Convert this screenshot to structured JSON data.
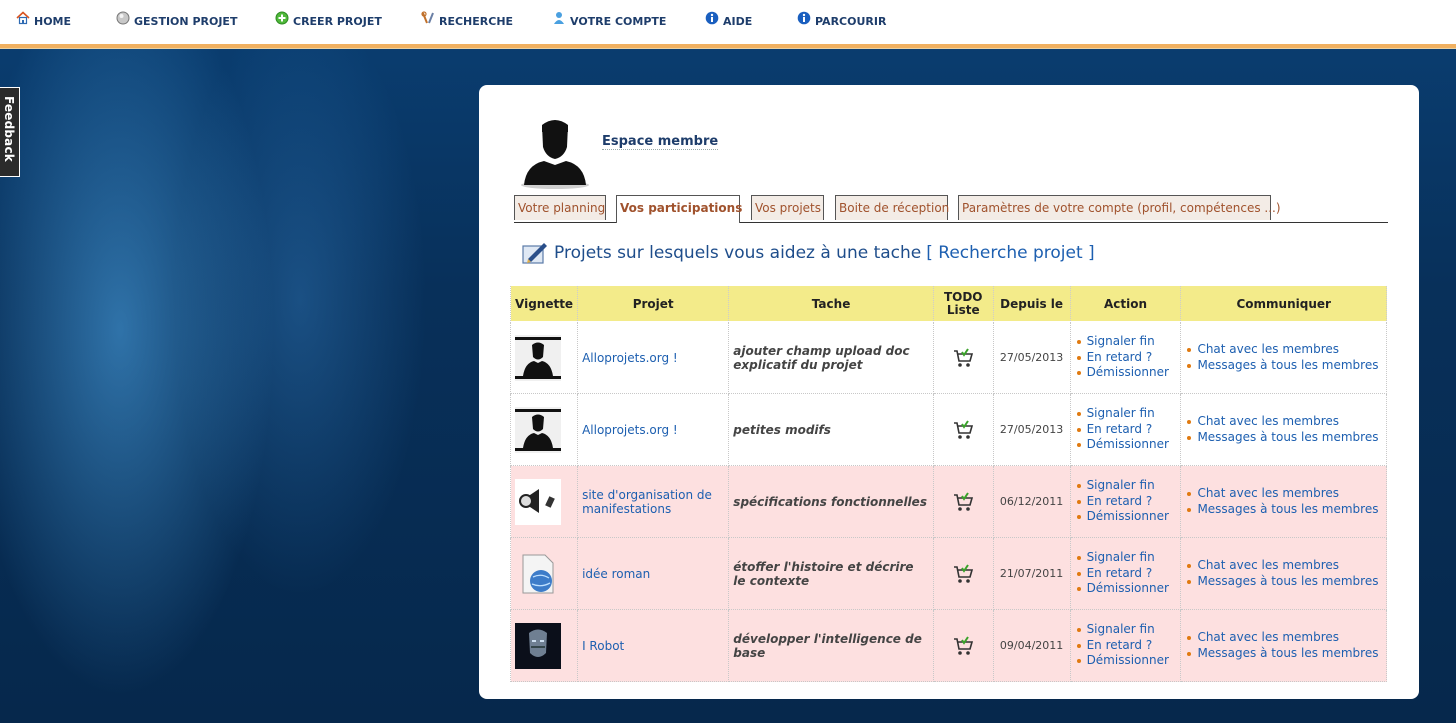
{
  "nav": {
    "items": [
      {
        "label": "HOME",
        "icon": "home-icon"
      },
      {
        "label": "GESTION PROJET",
        "icon": "gear-ball-icon"
      },
      {
        "label": "CREER PROJET",
        "icon": "add-icon"
      },
      {
        "label": "RECHERCHE",
        "icon": "tools-icon"
      },
      {
        "label": "VOTRE COMPTE",
        "icon": "user-icon"
      },
      {
        "label": "AIDE",
        "icon": "info-icon"
      },
      {
        "label": "PARCOURIR",
        "icon": "info-icon"
      }
    ]
  },
  "feedback": {
    "label": "Feedback"
  },
  "member": {
    "title": "Espace membre"
  },
  "tabs": [
    {
      "label": "Votre planning"
    },
    {
      "label": "Vos participations"
    },
    {
      "label": "Vos projets"
    },
    {
      "label": "Boite de réception"
    },
    {
      "label": "Paramètres de votre compte (profil, compétences ...)"
    }
  ],
  "section": {
    "title": "Projets sur lesquels vous aidez à une tache",
    "link": "[ Recherche projet ]"
  },
  "table": {
    "headers": {
      "vignette": "Vignette",
      "projet": "Projet",
      "tache": "Tache",
      "todo_1": "TODO",
      "todo_2": "Liste",
      "depuis": "Depuis le",
      "action": "Action",
      "communiquer": "Communiquer"
    },
    "actions": {
      "signal": "Signaler fin",
      "late": "En retard ?",
      "quit": "Démissionner",
      "chat": "Chat avec les membres",
      "msg": "Messages à tous les membres"
    },
    "rows": [
      {
        "project": "Alloprojets.org !",
        "task": "ajouter champ upload doc explicatif du projet",
        "date": "27/05/2013",
        "thumb": "silhouette"
      },
      {
        "project": "Alloprojets.org !",
        "task": "petites modifs",
        "date": "27/05/2013",
        "thumb": "silhouette"
      },
      {
        "project": "site d'organisation de manifestations",
        "task": "spécifications fonctionnelles",
        "date": "06/12/2011",
        "thumb": "megaphone"
      },
      {
        "project": "idée roman",
        "task": "étoffer l'histoire et décrire le contexte",
        "date": "21/07/2011",
        "thumb": "globe-document"
      },
      {
        "project": "I Robot",
        "task": "développer l'intelligence de base",
        "date": "09/04/2011",
        "thumb": "robot"
      }
    ]
  },
  "colors": {
    "header_bg": "#f3eb8a",
    "pink_row": "#fde0e0",
    "link_blue": "#1d5fb0",
    "nav_text": "#1e3d6b",
    "nav_border": "#f0b060"
  }
}
